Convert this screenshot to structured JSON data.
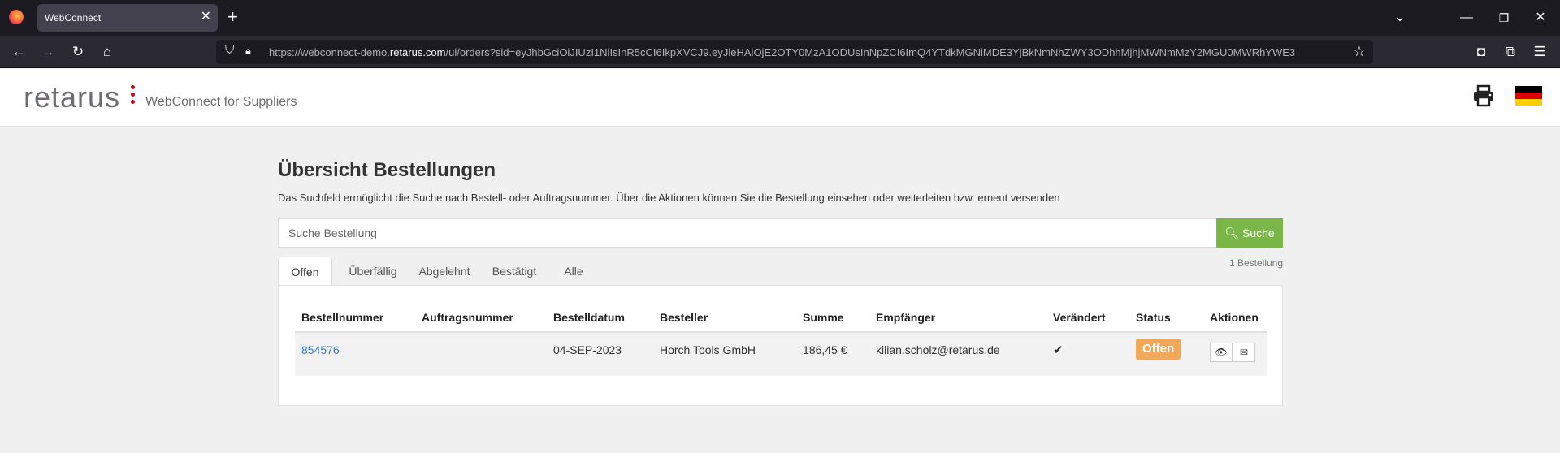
{
  "browser": {
    "tab_title": "WebConnect",
    "url_prefix": "https://webconnect-demo.",
    "url_domain": "retarus.com",
    "url_rest": "/ui/orders?sid=eyJhbGciOiJIUzI1NiIsInR5cCI6IkpXVCJ9.eyJleHAiOjE2OTY0MzA1ODUsInNpZCI6ImQ4YTdkMGNiMDE3YjBkNmNhZWY3ODhhMjhjMWNmMzY2MGU0MWRhYWE3"
  },
  "header": {
    "logo": "retarus",
    "subtitle": "WebConnect for Suppliers"
  },
  "main": {
    "title": "Übersicht Bestellungen",
    "description": "Das Suchfeld ermöglicht die Suche nach Bestell- oder Auftragsnummer. Über die Aktionen können Sie die Bestellung einsehen oder weiterleiten bzw. erneut versenden",
    "search_placeholder": "Suche Bestellung",
    "search_button": "Suche",
    "count": "1 Bestellung",
    "tabs": [
      "Offen",
      "Überfällig",
      "Abgelehnt",
      "Bestätigt",
      "Alle"
    ],
    "columns": [
      "Bestellnummer",
      "Auftragsnummer",
      "Bestelldatum",
      "Besteller",
      "Summe",
      "Empfänger",
      "Verändert",
      "Status",
      "Aktionen"
    ],
    "rows": [
      {
        "bestellnummer": "854576",
        "auftragsnummer": "",
        "bestelldatum": "04-SEP-2023",
        "besteller": "Horch Tools GmbH",
        "summe": "186,45 €",
        "empfaenger": "kilian.scholz@retarus.de",
        "status": "Offen"
      }
    ]
  },
  "colors": {
    "accent_green": "#7ab648",
    "status_orange": "#f0a85a",
    "link_blue": "#3a7fc1",
    "brand_red": "#d4001a"
  }
}
